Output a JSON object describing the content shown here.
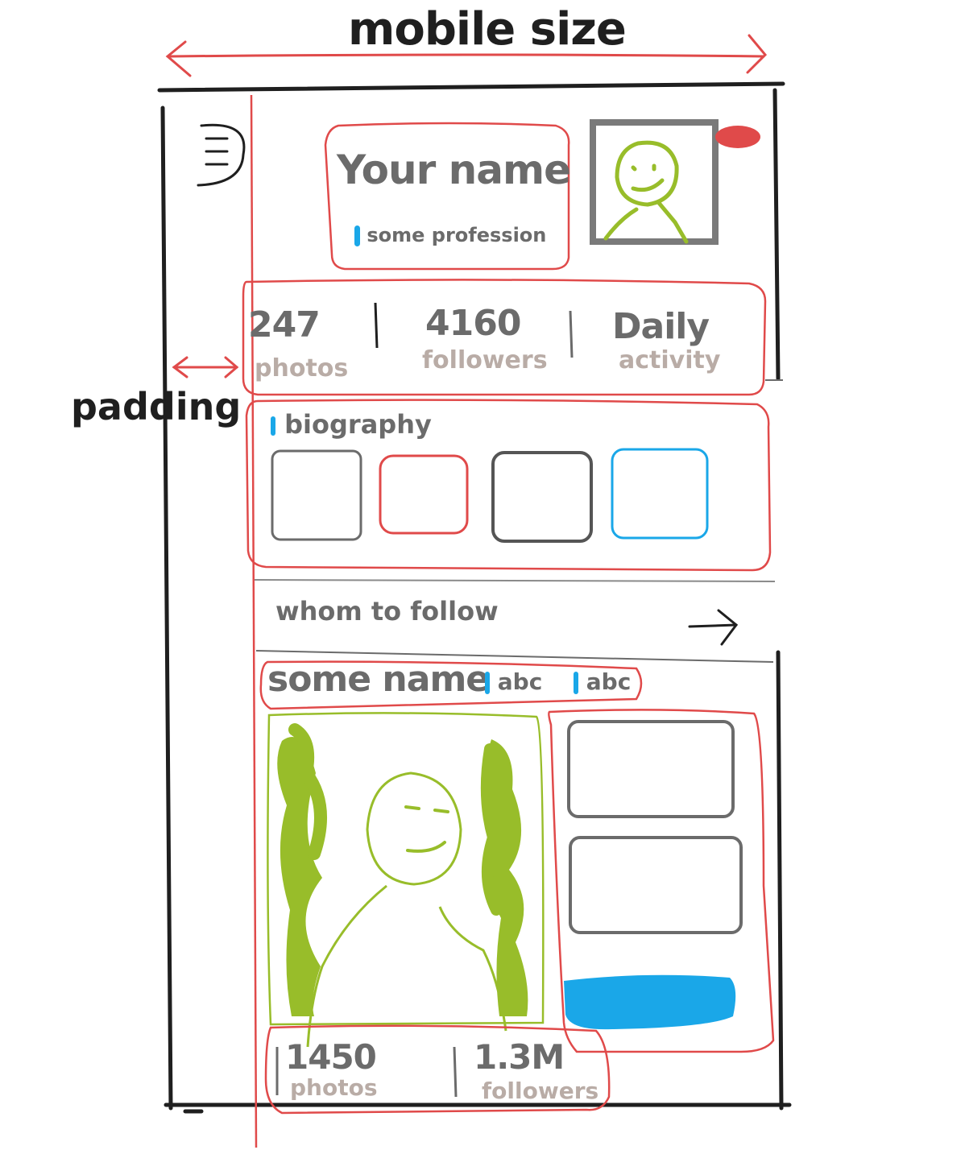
{
  "annotations": {
    "title": "mobile size",
    "padding": "padding"
  },
  "profile": {
    "name": "Your name",
    "profession": "some profession"
  },
  "stats": [
    {
      "value": "247",
      "label": "photos"
    },
    {
      "value": "4160",
      "label": "followers"
    },
    {
      "value": "Daily",
      "label": "activity"
    }
  ],
  "biography": {
    "label": "biography"
  },
  "follow": {
    "title": "whom to follow",
    "arrow_icon": "arrow-right-icon",
    "card": {
      "name": "some name",
      "tags": [
        "abc",
        "abc"
      ],
      "stats": [
        {
          "value": "1450",
          "label": "photos"
        },
        {
          "value": "1.3M",
          "label": "followers"
        }
      ]
    }
  },
  "colors": {
    "ink": "#1f1f1f",
    "grey": "#6b6b6b",
    "red": "#e04a4a",
    "green": "#98bd2a",
    "blue": "#1aa7e8",
    "tan": "#b9aca6"
  }
}
